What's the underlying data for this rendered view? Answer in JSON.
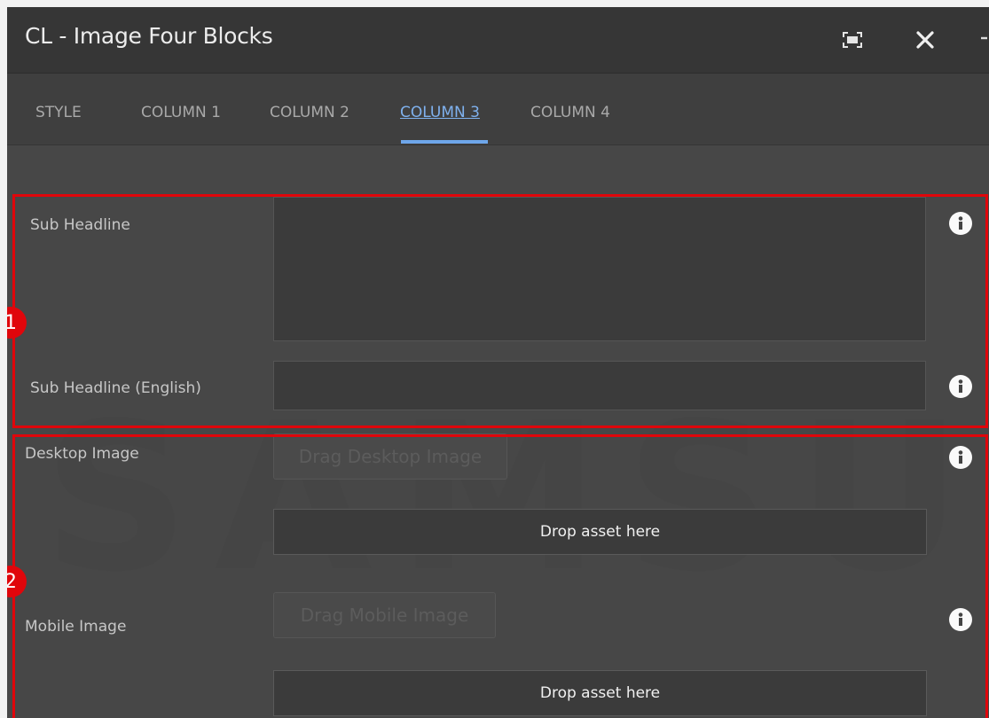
{
  "window": {
    "title": "CL - Image Four Blocks",
    "icons": [
      "fullscreen-icon",
      "close-icon",
      "more-icon"
    ]
  },
  "tabs": [
    {
      "label": "STYLE",
      "active": false
    },
    {
      "label": "COLUMN 1",
      "active": false
    },
    {
      "label": "COLUMN 2",
      "active": false
    },
    {
      "label": "COLUMN 3",
      "active": true
    },
    {
      "label": "COLUMN 4",
      "active": false
    }
  ],
  "fields": {
    "sub_headline": {
      "label": "Sub Headline",
      "value": ""
    },
    "sub_headline_en": {
      "label": "Sub Headline (English)",
      "value": ""
    },
    "desktop_image": {
      "label": "Desktop Image",
      "button": "Drag Desktop Image",
      "drop": "Drop asset here"
    },
    "mobile_image": {
      "label": "Mobile Image",
      "button": "Drag Mobile Image",
      "drop": "Drop asset here"
    }
  },
  "callouts": [
    "1",
    "2"
  ],
  "watermark": "SAMSUNG",
  "colors": {
    "accent": "#6ea6ea",
    "highlight": "#e0060b"
  }
}
